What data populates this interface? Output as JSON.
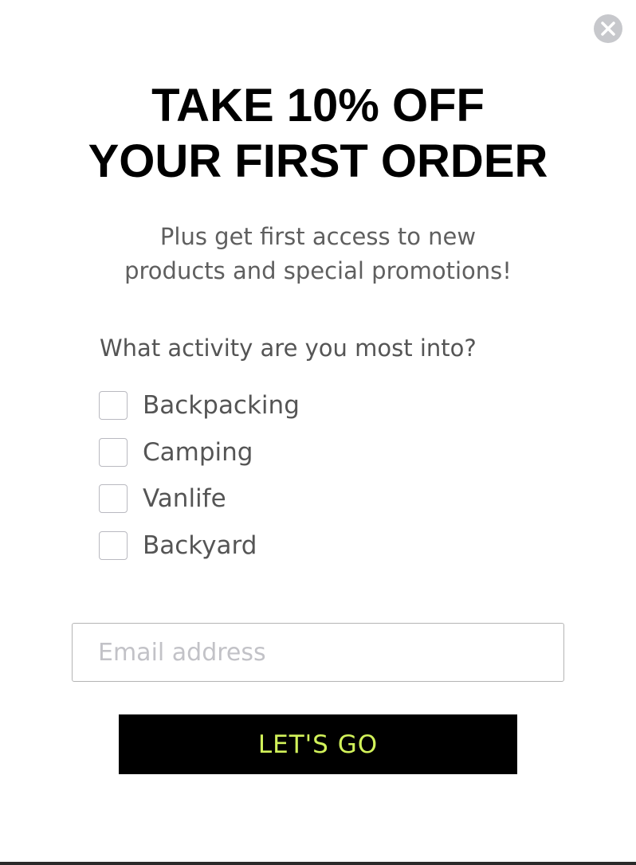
{
  "popup": {
    "close_icon": "close-icon",
    "headline": [
      "TAKE 10% OFF",
      "YOUR FIRST ORDER"
    ],
    "subtext": [
      "Plus get first access to new",
      "products and special promotions!"
    ],
    "question": "What activity are you most into?",
    "options": [
      {
        "label": "Backpacking",
        "checked": false
      },
      {
        "label": "Camping",
        "checked": false
      },
      {
        "label": "Vanlife",
        "checked": false
      },
      {
        "label": "Backyard",
        "checked": false
      }
    ],
    "email": {
      "placeholder": "Email address",
      "value": ""
    },
    "cta_label": "LET'S GO",
    "colors": {
      "cta_background": "#000000",
      "cta_text": "#d2f25a",
      "close_button": "#c7c8cc"
    }
  }
}
